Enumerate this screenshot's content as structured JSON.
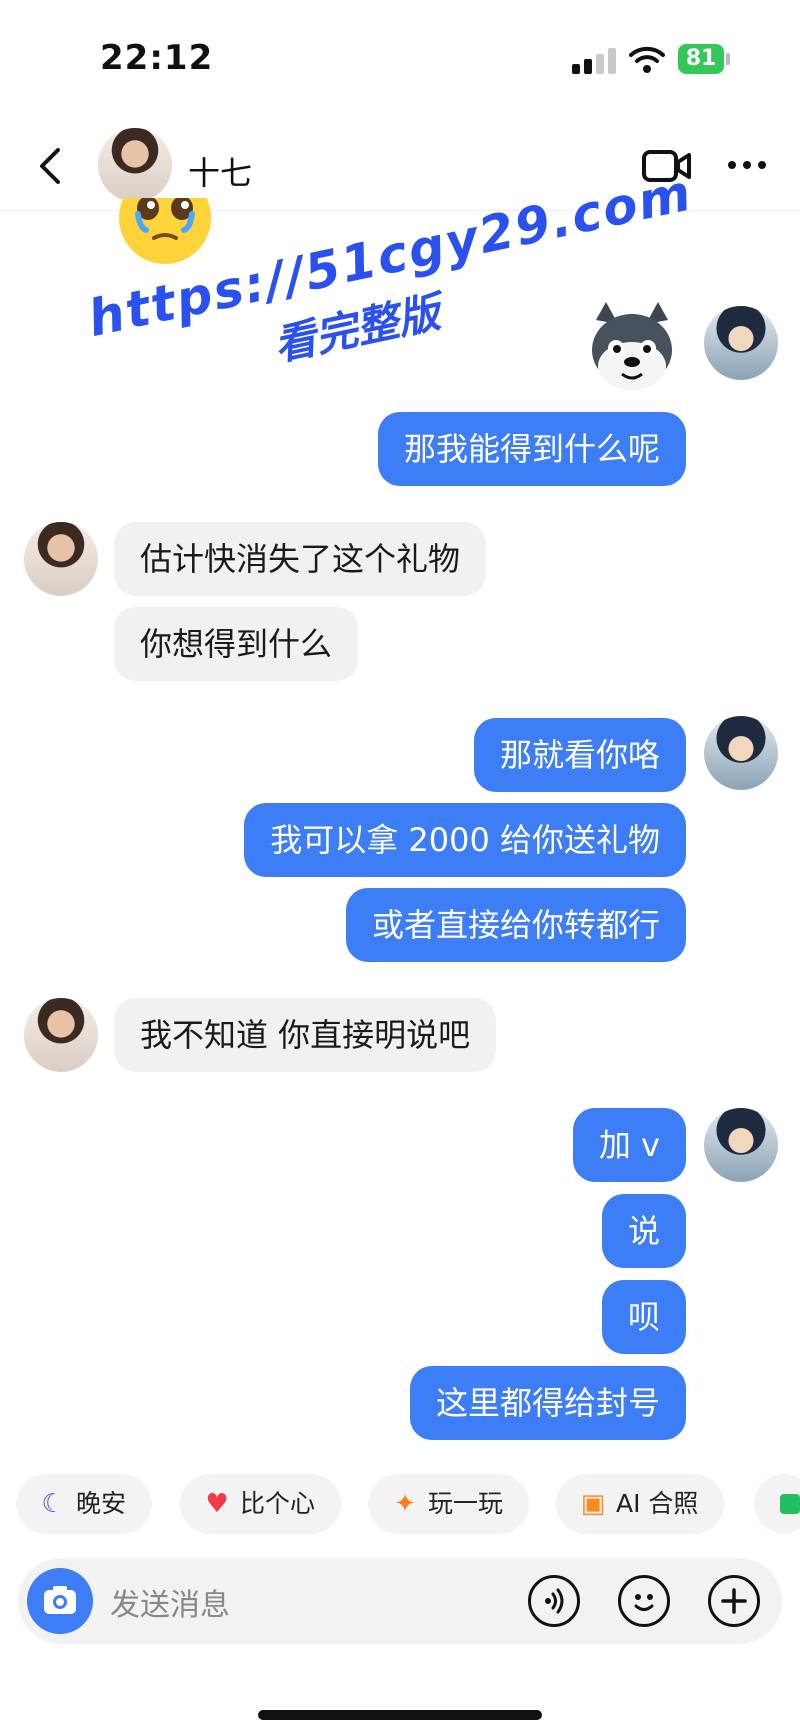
{
  "status_bar": {
    "time": "22:12",
    "battery": "81"
  },
  "header": {
    "contact_name": "十七"
  },
  "watermark": {
    "line1": "https://51cgy29.com",
    "line2": "看完整版"
  },
  "messages": [
    {
      "side": "out",
      "text": "那我能得到什么呢"
    },
    {
      "side": "in",
      "text": "估计快消失了这个礼物"
    },
    {
      "side": "in",
      "text": "你想得到什么"
    },
    {
      "side": "out",
      "text": "那就看你咯"
    },
    {
      "side": "out",
      "text": "我可以拿 2000 给你送礼物"
    },
    {
      "side": "out",
      "text": "或者直接给你转都行"
    },
    {
      "side": "in",
      "text": "我不知道 你直接明说吧"
    },
    {
      "side": "out",
      "text": "加 v"
    },
    {
      "side": "out",
      "text": "说"
    },
    {
      "side": "out",
      "text": "呗"
    },
    {
      "side": "out",
      "text": "这里都得给封号"
    }
  ],
  "quick_replies": [
    {
      "label": "晚安",
      "icon": "moon-icon"
    },
    {
      "label": "比个心",
      "icon": "heart-icon"
    },
    {
      "label": "玩一玩",
      "icon": "sparkle-icon"
    },
    {
      "label": "AI 合照",
      "icon": "photo-icon"
    }
  ],
  "input": {
    "placeholder": "发送消息"
  },
  "colors": {
    "accent": "#3d7ef7",
    "incoming_bubble": "#f1f1f2",
    "battery": "#34c759",
    "watermark": "#2b50f0"
  }
}
